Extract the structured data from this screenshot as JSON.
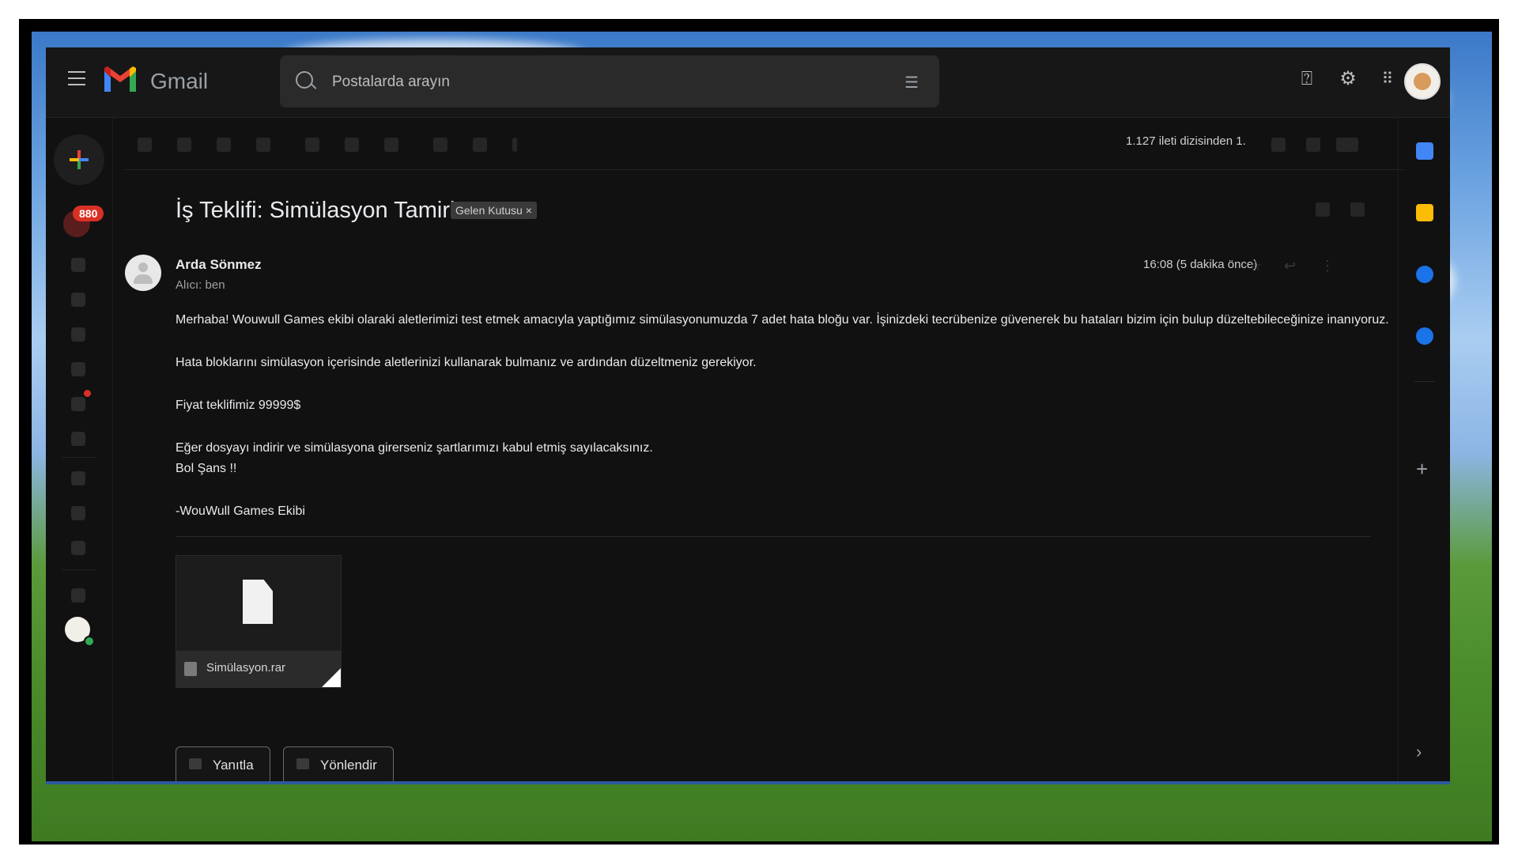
{
  "app": {
    "brand": "Gmail"
  },
  "search": {
    "placeholder": "Postalarda arayın"
  },
  "nav": {
    "badge_count": "880"
  },
  "toolbar": {
    "counter": "1.127 ileti dizisinden 1."
  },
  "email": {
    "subject": "İş Teklifi: Simülasyon Tamiri",
    "label": "Gelen Kutusu ×",
    "sender": "Arda Sönmez",
    "to": "Alıcı: ben",
    "time": "16:08 (5 dakika önce)",
    "body": [
      "Merhaba! Wouwull Games ekibi olaraki aletlerimizi test etmek amacıyla yaptığımız simülasyonumuzda 7 adet hata bloğu var. İşinizdeki tecrübenize güvenerek bu hataları bizim için bulup düzeltebileceğinize inanıyoruz.",
      "Hata bloklarını simülasyon içerisinde aletlerinizi kullanarak bulmanız ve ardından düzeltmeniz gerekiyor.",
      "Fiyat teklifimiz 99999$",
      "Eğer dosyayı indirir ve simülasyona girerseniz şartlarımızı kabul etmiş sayılacaksınız.",
      "Bol Şans !!",
      "-WouWull Games Ekibi"
    ],
    "attachment": {
      "name": "Simülasyon.rar"
    }
  },
  "actions": {
    "reply": "Yanıtla",
    "forward": "Yönlendir"
  },
  "colors": {
    "accent_red": "#d93025",
    "background": "#111111"
  }
}
